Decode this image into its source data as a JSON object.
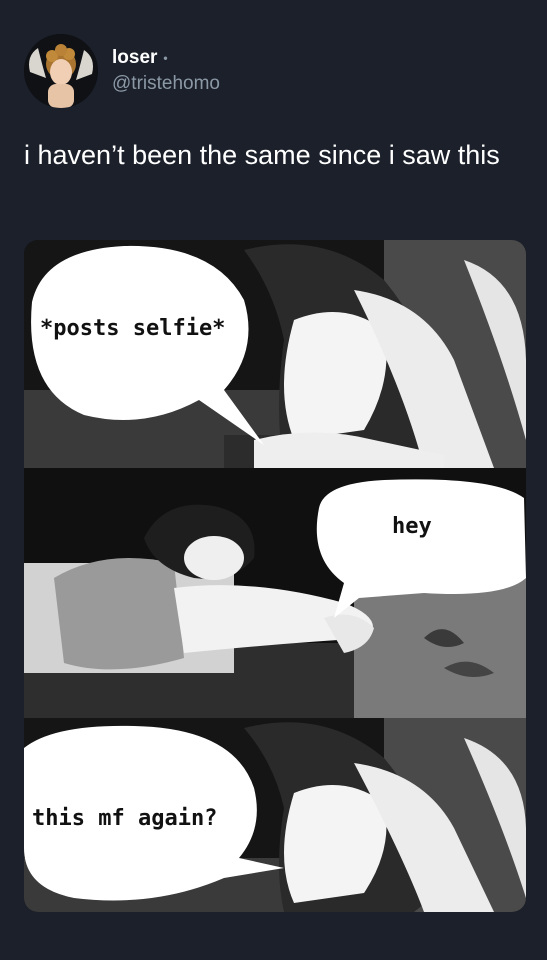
{
  "tweet": {
    "display_name": "loser",
    "verified_dot": "•",
    "handle": "@tristehomo",
    "text": "i haven’t been the same since i saw this"
  },
  "meme": {
    "panel1_caption": "*posts selfie*",
    "panel2_caption": "hey",
    "panel3_caption": "this mf again?"
  },
  "icons": {
    "avatar": "cherub-avatar-icon"
  },
  "colors": {
    "background": "#1b202b",
    "secondary_text": "#8b98a5"
  }
}
